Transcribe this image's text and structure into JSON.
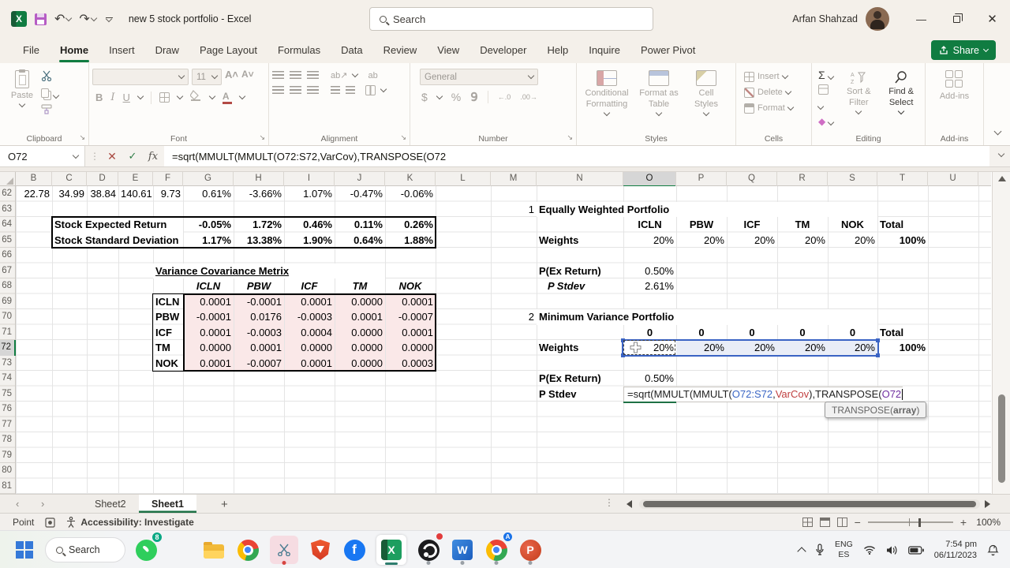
{
  "titlebar": {
    "title": "new 5 stock portfolio - Excel",
    "search_placeholder": "Search",
    "user_name": "Arfan Shahzad"
  },
  "tabs": [
    {
      "label": "File",
      "active": false
    },
    {
      "label": "Home",
      "active": true
    },
    {
      "label": "Insert",
      "active": false
    },
    {
      "label": "Draw",
      "active": false
    },
    {
      "label": "Page Layout",
      "active": false
    },
    {
      "label": "Formulas",
      "active": false
    },
    {
      "label": "Data",
      "active": false
    },
    {
      "label": "Review",
      "active": false
    },
    {
      "label": "View",
      "active": false
    },
    {
      "label": "Developer",
      "active": false
    },
    {
      "label": "Help",
      "active": false
    },
    {
      "label": "Inquire",
      "active": false
    },
    {
      "label": "Power Pivot",
      "active": false
    }
  ],
  "share_label": "Share",
  "ribbon": {
    "clipboard": {
      "label": "Clipboard",
      "paste": "Paste"
    },
    "font": {
      "label": "Font",
      "size": "11"
    },
    "alignment": {
      "label": "Alignment"
    },
    "number": {
      "label": "Number",
      "format": "General"
    },
    "styles": {
      "label": "Styles",
      "conditional": "Conditional Formatting",
      "format_table": "Format as Table",
      "cell_styles": "Cell Styles"
    },
    "cells": {
      "label": "Cells",
      "insert": "Insert",
      "delete": "Delete",
      "format": "Format"
    },
    "editing": {
      "label": "Editing",
      "sort": "Sort & Filter",
      "find": "Find & Select"
    },
    "addins": {
      "label": "Add-ins",
      "button": "Add-ins"
    }
  },
  "formula_bar": {
    "name_box": "O72",
    "formula": "=sqrt(MMULT(MMULT(O72:S72,VarCov),TRANSPOSE(O72"
  },
  "grid": {
    "columns": [
      "B",
      "C",
      "D",
      "E",
      "F",
      "G",
      "H",
      "I",
      "J",
      "K",
      "L",
      "M",
      "N",
      "O",
      "P",
      "Q",
      "R",
      "S",
      "T",
      "U"
    ],
    "rows": [
      62,
      63,
      64,
      65,
      66,
      67,
      68,
      69,
      70,
      71,
      72,
      73,
      74,
      75,
      76,
      77,
      78,
      79,
      80,
      81
    ],
    "selected_column": "O",
    "selected_row": 72
  },
  "cells": [
    {
      "a": "B62",
      "v": "22.78"
    },
    {
      "a": "C62",
      "v": "34.99"
    },
    {
      "a": "D62",
      "v": "38.84"
    },
    {
      "a": "E62",
      "v": "140.61"
    },
    {
      "a": "F62",
      "v": "9.73"
    },
    {
      "a": "G62",
      "v": "0.61%"
    },
    {
      "a": "H62",
      "v": "-3.66%"
    },
    {
      "a": "I62",
      "v": "1.07%"
    },
    {
      "a": "J62",
      "v": "-0.47%"
    },
    {
      "a": "K62",
      "v": "-0.06%"
    },
    {
      "a": "C64",
      "v": "Stock Expected Return",
      "b": 1,
      "al": "l",
      "sp": "F"
    },
    {
      "a": "G64",
      "v": "-0.05%",
      "b": 1
    },
    {
      "a": "H64",
      "v": "1.72%",
      "b": 1
    },
    {
      "a": "I64",
      "v": "0.46%",
      "b": 1
    },
    {
      "a": "J64",
      "v": "0.11%",
      "b": 1
    },
    {
      "a": "K64",
      "v": "0.26%",
      "b": 1
    },
    {
      "a": "C65",
      "v": "Stock Standard Deviation",
      "b": 1,
      "al": "l",
      "sp": "F"
    },
    {
      "a": "G65",
      "v": "1.17%",
      "b": 1
    },
    {
      "a": "H65",
      "v": "13.38%",
      "b": 1
    },
    {
      "a": "I65",
      "v": "1.90%",
      "b": 1
    },
    {
      "a": "J65",
      "v": "0.64%",
      "b": 1
    },
    {
      "a": "K65",
      "v": "1.88%",
      "b": 1
    },
    {
      "a": "F67",
      "v": "Variance Covariance Metrix",
      "b": 1,
      "u": 1,
      "al": "l",
      "sp": "J"
    },
    {
      "a": "G68",
      "v": "ICLN",
      "b": 1,
      "i": 1,
      "al": "c"
    },
    {
      "a": "H68",
      "v": "PBW",
      "b": 1,
      "i": 1,
      "al": "c"
    },
    {
      "a": "I68",
      "v": "ICF",
      "b": 1,
      "i": 1,
      "al": "c"
    },
    {
      "a": "J68",
      "v": "TM",
      "b": 1,
      "i": 1,
      "al": "c"
    },
    {
      "a": "K68",
      "v": "NOK",
      "b": 1,
      "i": 1,
      "al": "c"
    },
    {
      "a": "F69",
      "v": "ICLN",
      "b": 1,
      "al": "l"
    },
    {
      "a": "G69",
      "v": "0.0001"
    },
    {
      "a": "H69",
      "v": "-0.0001"
    },
    {
      "a": "I69",
      "v": "0.0001"
    },
    {
      "a": "J69",
      "v": "0.0000"
    },
    {
      "a": "K69",
      "v": "0.0001"
    },
    {
      "a": "F70",
      "v": "PBW",
      "b": 1,
      "al": "l"
    },
    {
      "a": "G70",
      "v": "-0.0001"
    },
    {
      "a": "H70",
      "v": "0.0176"
    },
    {
      "a": "I70",
      "v": "-0.0003"
    },
    {
      "a": "J70",
      "v": "0.0001"
    },
    {
      "a": "K70",
      "v": "-0.0007"
    },
    {
      "a": "F71",
      "v": "ICF",
      "b": 1,
      "al": "l"
    },
    {
      "a": "G71",
      "v": "0.0001"
    },
    {
      "a": "H71",
      "v": "-0.0003"
    },
    {
      "a": "I71",
      "v": "0.0004"
    },
    {
      "a": "J71",
      "v": "0.0000"
    },
    {
      "a": "K71",
      "v": "0.0001"
    },
    {
      "a": "F72",
      "v": "TM",
      "b": 1,
      "al": "l"
    },
    {
      "a": "G72",
      "v": "0.0000"
    },
    {
      "a": "H72",
      "v": "0.0001"
    },
    {
      "a": "I72",
      "v": "0.0000"
    },
    {
      "a": "J72",
      "v": "0.0000"
    },
    {
      "a": "K72",
      "v": "0.0000"
    },
    {
      "a": "F73",
      "v": "NOK",
      "b": 1,
      "al": "l"
    },
    {
      "a": "G73",
      "v": "0.0001"
    },
    {
      "a": "H73",
      "v": "-0.0007"
    },
    {
      "a": "I73",
      "v": "0.0001"
    },
    {
      "a": "J73",
      "v": "0.0000"
    },
    {
      "a": "K73",
      "v": "0.0003"
    },
    {
      "a": "M63",
      "v": "1"
    },
    {
      "a": "N63",
      "v": "Equally Weighted Portfolio",
      "b": 1,
      "al": "l",
      "sp": "S"
    },
    {
      "a": "O64",
      "v": "ICLN",
      "b": 1,
      "al": "c"
    },
    {
      "a": "P64",
      "v": "PBW",
      "b": 1,
      "al": "c"
    },
    {
      "a": "Q64",
      "v": "ICF",
      "b": 1,
      "al": "c"
    },
    {
      "a": "R64",
      "v": "TM",
      "b": 1,
      "al": "c"
    },
    {
      "a": "S64",
      "v": "NOK",
      "b": 1,
      "al": "c"
    },
    {
      "a": "T64",
      "v": "Total",
      "b": 1,
      "al": "l"
    },
    {
      "a": "N65",
      "v": "Weights",
      "b": 1,
      "al": "l"
    },
    {
      "a": "O65",
      "v": "20%"
    },
    {
      "a": "P65",
      "v": "20%"
    },
    {
      "a": "Q65",
      "v": "20%"
    },
    {
      "a": "R65",
      "v": "20%"
    },
    {
      "a": "S65",
      "v": "20%"
    },
    {
      "a": "T65",
      "v": "100%",
      "b": 1
    },
    {
      "a": "N67",
      "v": "P(Ex Return)",
      "b": 1,
      "al": "l"
    },
    {
      "a": "O67",
      "v": "0.50%"
    },
    {
      "a": "N68",
      "v": "P Stdev",
      "b": 1,
      "i": 1,
      "al": "l",
      "ind": 1
    },
    {
      "a": "O68",
      "v": "2.61%"
    },
    {
      "a": "M70",
      "v": "2"
    },
    {
      "a": "N70",
      "v": "Minimum Variance Portfolio",
      "b": 1,
      "al": "l",
      "sp": "S"
    },
    {
      "a": "O71",
      "v": "0",
      "b": 1,
      "al": "c"
    },
    {
      "a": "P71",
      "v": "0",
      "b": 1,
      "al": "c"
    },
    {
      "a": "Q71",
      "v": "0",
      "b": 1,
      "al": "c"
    },
    {
      "a": "R71",
      "v": "0",
      "b": 1,
      "al": "c"
    },
    {
      "a": "S71",
      "v": "0",
      "b": 1,
      "al": "c"
    },
    {
      "a": "T71",
      "v": "Total",
      "b": 1,
      "al": "l"
    },
    {
      "a": "N72",
      "v": "Weights",
      "b": 1,
      "al": "l"
    },
    {
      "a": "O72",
      "v": "20%"
    },
    {
      "a": "P72",
      "v": "20%",
      "bg": "sel"
    },
    {
      "a": "Q72",
      "v": "20%",
      "bg": "sel"
    },
    {
      "a": "R72",
      "v": "20%",
      "bg": "sel"
    },
    {
      "a": "S72",
      "v": "20%",
      "bg": "sel"
    },
    {
      "a": "T72",
      "v": "100%",
      "b": 1
    },
    {
      "a": "N74",
      "v": "P(Ex Return)",
      "b": 1,
      "al": "l"
    },
    {
      "a": "O74",
      "v": "0.50%"
    },
    {
      "a": "N75",
      "v": "P Stdev",
      "b": 1,
      "al": "l"
    }
  ],
  "cell_formula": {
    "pre": "=sqrt(MMULT(MMULT(",
    "ref1": "O72:S72",
    "sep1": ",",
    "ref2": "VarCov",
    "sep2": "),TRANSPOSE(",
    "ref3": "O72"
  },
  "function_tooltip": {
    "fn": "TRANSPOSE(",
    "arg": "array",
    "close": ")"
  },
  "sheet_tabs": [
    {
      "label": "Sheet2",
      "active": false
    },
    {
      "label": "Sheet1",
      "active": true
    }
  ],
  "status": {
    "mode": "Point",
    "accessibility": "Accessibility: Investigate",
    "zoom_level": "100%"
  },
  "taskbar": {
    "search_label": "Search",
    "whatsapp_badge": "8",
    "language_line1": "ENG",
    "language_line2": "ES",
    "time": "7:54 pm",
    "date": "06/11/2023"
  },
  "colors": {
    "accent_green": "#107c41",
    "selection_blue": "#3a63c4",
    "ref_blue": "#3b66c5",
    "ref_red": "#c04141",
    "ref_purple": "#7030a0",
    "matrix_pink": "#fae8e8"
  }
}
